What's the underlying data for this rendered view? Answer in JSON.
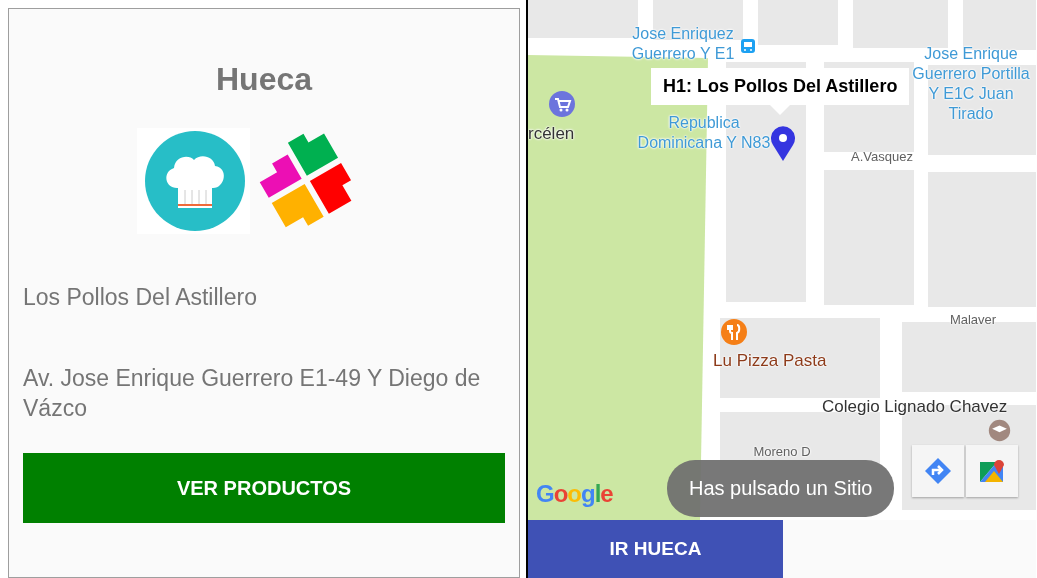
{
  "detail": {
    "title": "Hueca",
    "name": "Los Pollos Del Astillero",
    "address": "Av. Jose Enrique Guerrero E1-49 Y Diego de Vázco",
    "button": "VER PRODUCTOS"
  },
  "map": {
    "info_window": "H1: Los Pollos Del Astillero",
    "labels": [
      {
        "text": "Jose Enriquez Guerrero Y E1",
        "kind": "transit"
      },
      {
        "text": "Jose Enrique Guerrero Portilla Y E1C Juan Tirado",
        "kind": "transit"
      },
      {
        "text": "rcélen",
        "kind": "place"
      },
      {
        "text": "Republica Dominicana Y N83",
        "kind": "transit"
      },
      {
        "text": "A.Vasquez",
        "kind": "street"
      },
      {
        "text": "Malaver",
        "kind": "street"
      },
      {
        "text": "Lu Pizza Pasta",
        "kind": "food"
      },
      {
        "text": "Colegio Lignado Chavez",
        "kind": "place"
      },
      {
        "text": "Moreno D",
        "kind": "street"
      }
    ],
    "logo": "Google",
    "toast": "Has pulsado un Sitio"
  },
  "button": "IR HUECA"
}
